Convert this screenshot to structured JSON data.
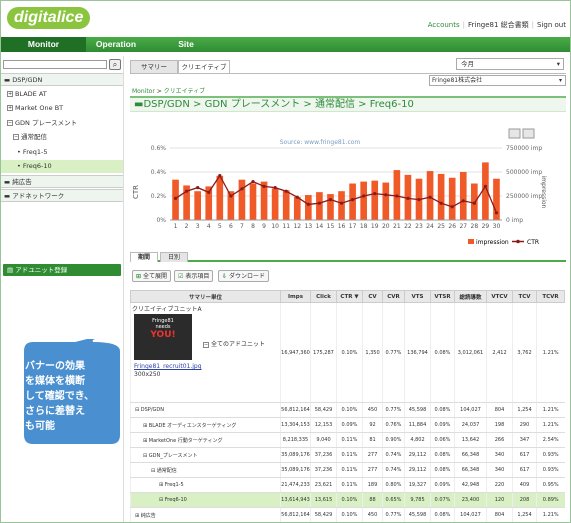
{
  "header": {
    "logo": "digitalice",
    "links": [
      "Accounts",
      "Fringe81 総合書類",
      "Sign out"
    ]
  },
  "nav": {
    "tabs": [
      "Monitor",
      "Operation",
      "Site"
    ],
    "account": "Fringe81株式会社"
  },
  "sidebar": {
    "items": [
      "DSP/GDN",
      "BLADE AT",
      "Market One BT",
      "GDN プレースメント",
      "通常配信",
      "Freq1-5",
      "Freq6-10",
      "純広告",
      "アドネットワーク"
    ],
    "register_button": "アドユニット登録"
  },
  "main": {
    "tabs": [
      "サマリー",
      "クリエイティブ"
    ],
    "period": "今月",
    "breadcrumb": {
      "root": "Monitor",
      "sep": " > ",
      "current": "クリエイティブ"
    },
    "big_crumb": [
      "DSP/GDN",
      "GDN プレースメント",
      "通常配信",
      "Freq6-10"
    ],
    "period_tabs": [
      "期間",
      "日別"
    ],
    "actions": [
      "全て展開",
      "表示項目",
      "ダウンロード"
    ]
  },
  "chart_data": {
    "type": "bar",
    "source_label": "Source: www.fringe81.com",
    "categories": [
      "1",
      "2",
      "3",
      "4",
      "5",
      "6",
      "7",
      "8",
      "9",
      "10",
      "11",
      "12",
      "13",
      "14",
      "15",
      "16",
      "17",
      "18",
      "19",
      "20",
      "21",
      "22",
      "23",
      "24",
      "25",
      "26",
      "27",
      "28",
      "29",
      "30"
    ],
    "series": [
      {
        "name": "impression",
        "axis": "right",
        "values": [
          420000,
          360000,
          300000,
          350000,
          460000,
          300000,
          420000,
          380000,
          400000,
          330000,
          310000,
          240000,
          260000,
          290000,
          270000,
          300000,
          380000,
          400000,
          410000,
          390000,
          520000,
          470000,
          430000,
          510000,
          480000,
          440000,
          500000,
          380000,
          600000,
          430000
        ]
      },
      {
        "name": "CTR",
        "axis": "left",
        "values": [
          0.18,
          0.24,
          0.27,
          0.23,
          0.37,
          0.2,
          0.26,
          0.32,
          0.28,
          0.27,
          0.24,
          0.19,
          0.13,
          0.14,
          0.17,
          0.14,
          0.17,
          0.2,
          0.22,
          0.21,
          0.2,
          0.18,
          0.17,
          0.19,
          0.14,
          0.11,
          0.16,
          0.14,
          0.28,
          0.06
        ]
      }
    ],
    "y_left": {
      "label": "CTR",
      "ticks": [
        "0%",
        "0.2%",
        "0.4%",
        "0.6%"
      ],
      "ylim": [
        0,
        0.6
      ]
    },
    "y_right": {
      "label": "impression",
      "ticks": [
        "0 imp",
        "250000 imp",
        "500000 imp",
        "750000 imp"
      ],
      "ylim": [
        0,
        750000
      ]
    },
    "legend": [
      "impression",
      "CTR"
    ],
    "legend_position": "bottom-right",
    "colors": {
      "bar": "#ef5a28",
      "line": "#8b1a1a"
    }
  },
  "table": {
    "headers": [
      "サマリー単位",
      "Imps",
      "Click",
      "CTR ▼",
      "CV",
      "CVR",
      "VTS",
      "VTSR",
      "総読導数",
      "VTCV",
      "TCV",
      "TCVR"
    ],
    "creative_title": "クリエイティブユニットA",
    "poster_lines": [
      "Fringe81",
      "needs",
      "YOU!"
    ],
    "file_link": "Fringe81_recruit01.jpg",
    "file_size": "300x250",
    "all_units": "全てのアドユニット",
    "top_row": [
      "16,947,360",
      "175,287",
      "0.10%",
      "1,350",
      "0.77%",
      "136,794",
      "0.08%",
      "3,012,061",
      "2,412",
      "3,762",
      "1.21%"
    ],
    "rows": [
      {
        "icon": "⊟",
        "indent": 4,
        "name": "DSP/GDN",
        "v": [
          "56,812,164",
          "58,429",
          "0.10%",
          "450",
          "0.77%",
          "45,598",
          "0.08%",
          "104,027",
          "804",
          "1,254",
          "1.21%"
        ]
      },
      {
        "icon": "⊞",
        "indent": 12,
        "name": "BLADE オーディエンスターゲティング",
        "v": [
          "13,304,153",
          "12,153",
          "0.09%",
          "92",
          "0.76%",
          "11,884",
          "0.09%",
          "24,037",
          "198",
          "290",
          "1.21%"
        ]
      },
      {
        "icon": "⊞",
        "indent": 12,
        "name": "MarketOne 行動ターゲティング",
        "v": [
          "8,218,335",
          "9,040",
          "0.11%",
          "81",
          "0.90%",
          "4,802",
          "0.06%",
          "13,642",
          "266",
          "347",
          "2.54%"
        ]
      },
      {
        "icon": "⊟",
        "indent": 12,
        "name": "GDN_プレースメント",
        "v": [
          "35,089,176",
          "37,236",
          "0.11%",
          "277",
          "0.74%",
          "29,112",
          "0.08%",
          "66,348",
          "340",
          "617",
          "0.93%"
        ]
      },
      {
        "icon": "⊟",
        "indent": 20,
        "name": "通常配信",
        "v": [
          "35,089,176",
          "37,236",
          "0.11%",
          "277",
          "0.74%",
          "29,112",
          "0.08%",
          "66,348",
          "340",
          "617",
          "0.93%"
        ]
      },
      {
        "icon": "⊞",
        "indent": 28,
        "name": "Freq1-5",
        "v": [
          "21,474,233",
          "23,621",
          "0.11%",
          "189",
          "0.80%",
          "19,327",
          "0.09%",
          "42,948",
          "220",
          "409",
          "0.95%"
        ]
      },
      {
        "icon": "⊟",
        "indent": 28,
        "name": "Freq6-10",
        "v": [
          "13,614,943",
          "13,615",
          "0.10%",
          "88",
          "0.65%",
          "9,785",
          "0.07%",
          "23,400",
          "120",
          "208",
          "0.89%"
        ],
        "sel": true
      },
      {
        "icon": "⊞",
        "indent": 4,
        "name": "純広告",
        "v": [
          "56,812,164",
          "58,429",
          "0.10%",
          "450",
          "0.77%",
          "45,598",
          "0.08%",
          "104,027",
          "804",
          "1,254",
          "1.21%"
        ]
      },
      {
        "icon": "⊞",
        "indent": 4,
        "name": "アドネットワーク",
        "v": [
          "56,812,164",
          "58,429",
          "0.10%",
          "450",
          "0.77%",
          "45,598",
          "0.08%",
          "104,027",
          "804",
          "1,254",
          "1.21%"
        ]
      }
    ]
  },
  "callout": {
    "text": "バナーの効果\nを媒体を横断\nして確認でき、\nさらに差替え\nも可能"
  }
}
